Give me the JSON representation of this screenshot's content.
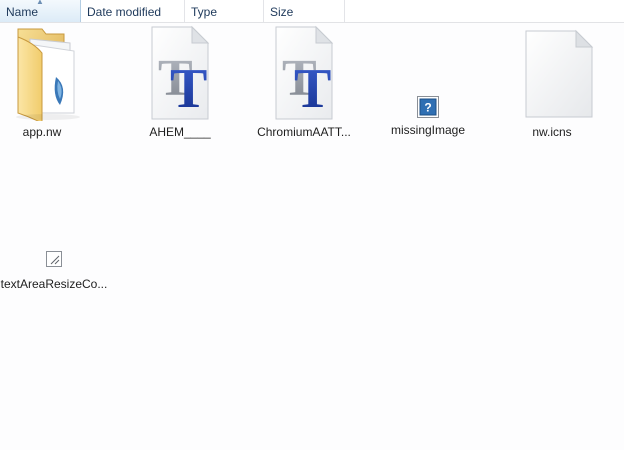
{
  "columns": {
    "name": "Name",
    "date_modified": "Date modified",
    "type": "Type",
    "size": "Size"
  },
  "items": [
    {
      "label": "app.nw",
      "icon": "folder-icon"
    },
    {
      "label": "AHEM____",
      "icon": "truetype-font-icon"
    },
    {
      "label": "ChromiumAATT...",
      "icon": "truetype-font-icon"
    },
    {
      "label": "missingImage",
      "icon": "missing-image-icon"
    },
    {
      "label": "nw.icns",
      "icon": "blank-file-icon"
    },
    {
      "label": "textAreaResizeCo...",
      "icon": "resize-corner-image-icon"
    }
  ],
  "colors": {
    "header_text": "#1e395b",
    "sorted_column_top": "#f4f9fd",
    "sorted_column_bottom": "#dcebf7",
    "folder": "#f5d57a",
    "font_blue": "#1f3fa8"
  }
}
